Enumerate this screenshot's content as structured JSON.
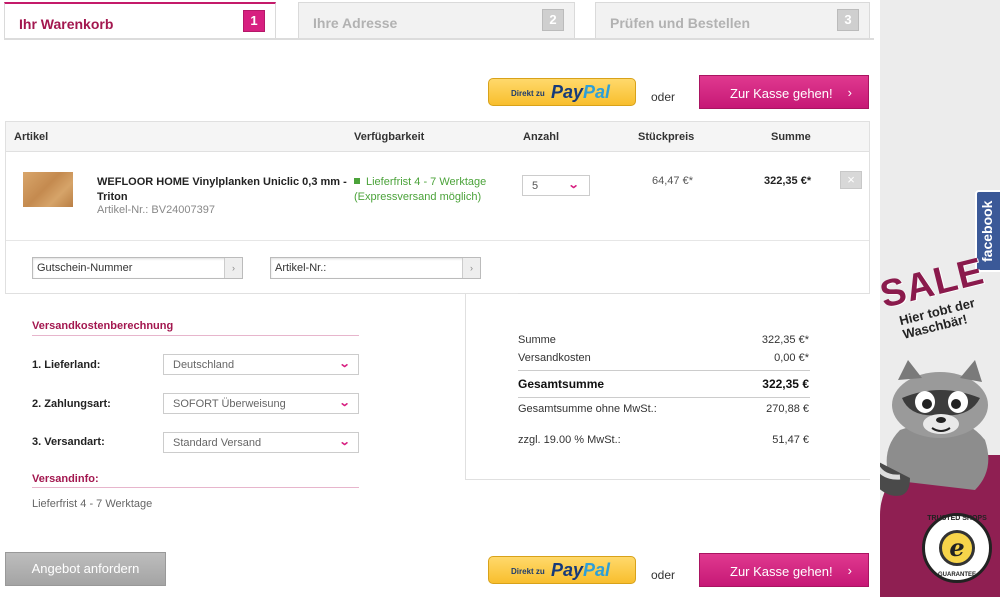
{
  "steps": [
    {
      "label": "Ihr Warenkorb",
      "num": "1"
    },
    {
      "label": "Ihre Adresse",
      "num": "2"
    },
    {
      "label": "Prüfen und Bestellen",
      "num": "3"
    }
  ],
  "paypal": {
    "small": "Direkt zu",
    "pay": "Pay",
    "pal": "Pal"
  },
  "oder": "oder",
  "checkout_label": "Zur Kasse gehen!",
  "checkout_arrow": "›",
  "table": {
    "headers": {
      "artikel": "Artikel",
      "verfuegbarkeit": "Verfügbarkeit",
      "anzahl": "Anzahl",
      "stueckpreis": "Stückpreis",
      "summe": "Summe"
    },
    "item": {
      "name": "WEFLOOR HOME Vinylplanken Uniclic 0,3 mm - Triton",
      "sku": "Artikel-Nr.: BV24007397",
      "availability_1": "Lieferfrist 4 - 7 Werktage",
      "availability_2": "(Expressversand möglich)",
      "quantity": "5",
      "unit_price": "64,47 €*",
      "sum": "322,35 €*",
      "remove": "×"
    }
  },
  "voucher_placeholder": "Gutschein-Nummer",
  "article_placeholder": "Artikel-Nr.:",
  "go_arrow": "›",
  "shipping": {
    "title": "Versandkostenberechnung",
    "country_label": "1. Lieferland:",
    "country_value": "Deutschland",
    "payment_label": "2. Zahlungsart:",
    "payment_value": "SOFORT Überweisung",
    "method_label": "3. Versandart:",
    "method_value": "Standard Versand",
    "info_title": "Versandinfo:",
    "info_text": "Lieferfrist 4 - 7 Werktage"
  },
  "totals": {
    "summe_label": "Summe",
    "summe_value": "322,35 €*",
    "versand_label": "Versandkosten",
    "versand_value": "0,00 €*",
    "gesamt_label": "Gesamtsumme",
    "gesamt_value": "322,35 €",
    "netto_label": "Gesamtsumme ohne MwSt.:",
    "netto_value": "270,88 €",
    "mwst_label": "zzgl. 19.00 % MwSt.:",
    "mwst_value": "51,47 €"
  },
  "quote_label": "Angebot anfordern",
  "sidebar": {
    "facebook": "facebook",
    "sale": "SALE",
    "sale_line1": "Hier tobt der",
    "sale_line2": "Waschbär!",
    "trusted_top": "TRUSTED SHOPS",
    "trusted_bottom": "GUARANTEE",
    "trusted_mark": "e"
  },
  "colors": {
    "accent": "#d71f80",
    "brand_dark": "#a3174f",
    "available": "#4ba33a"
  }
}
